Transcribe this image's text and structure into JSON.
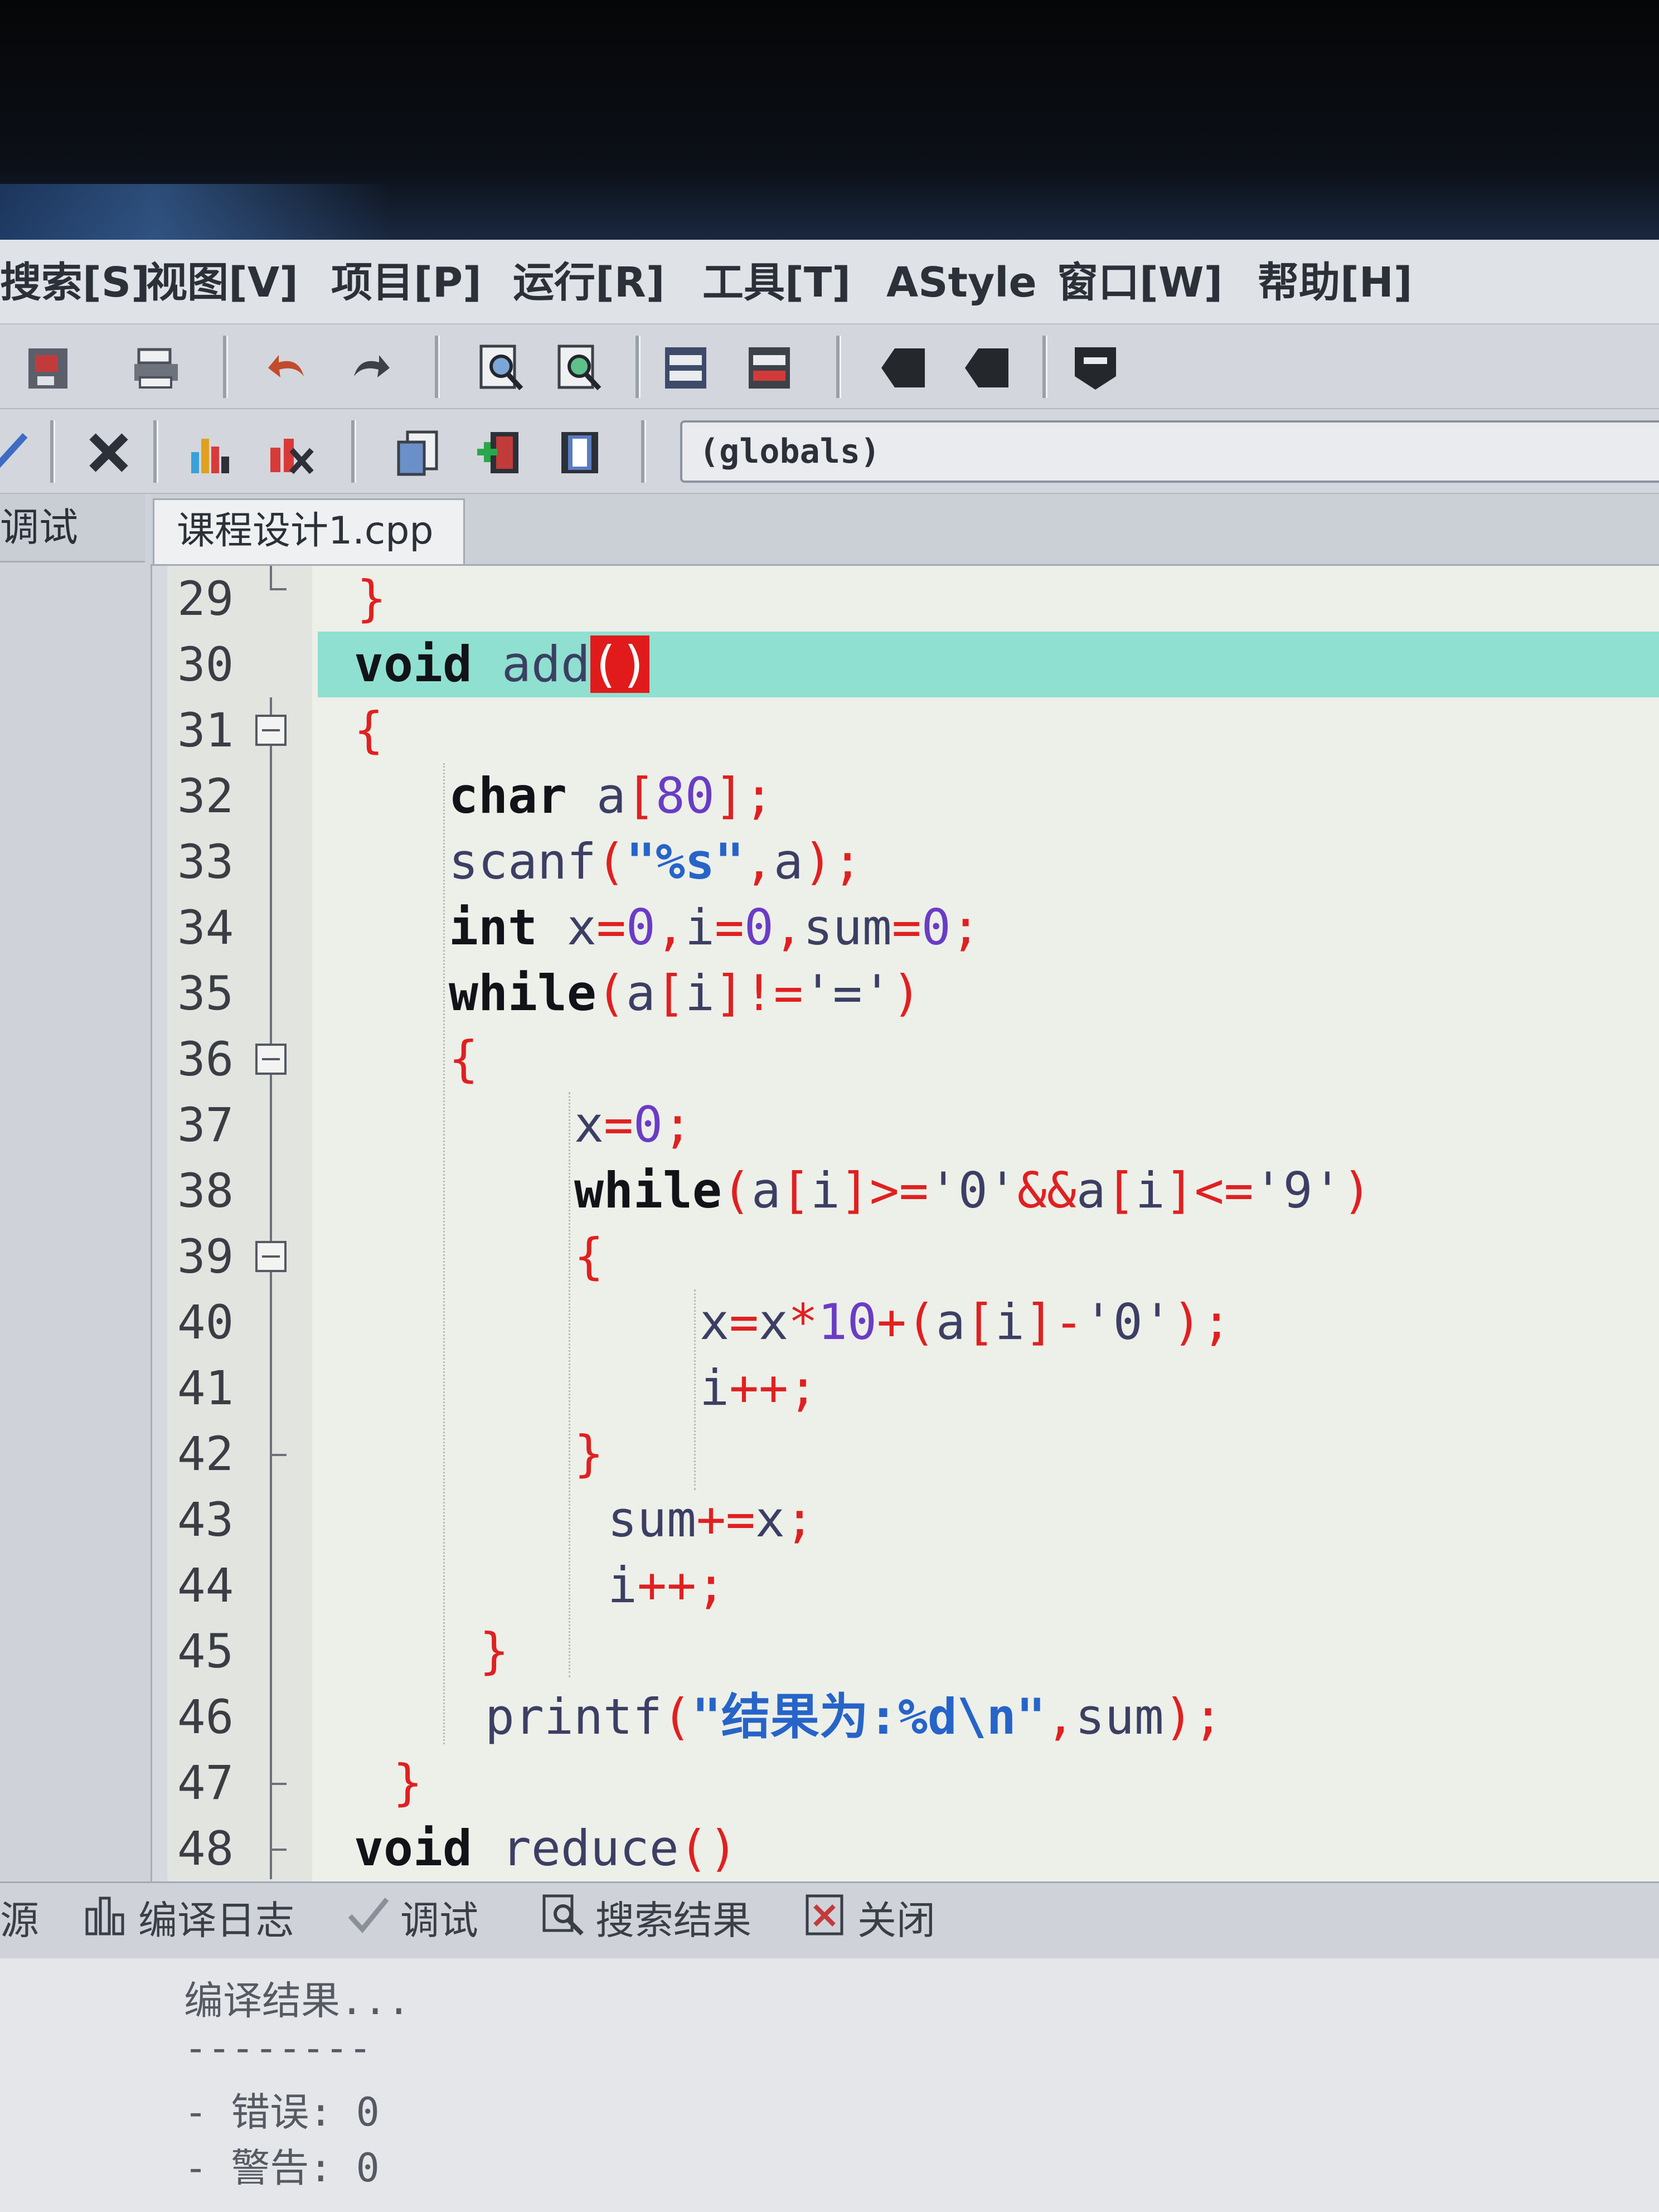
{
  "menu": [
    "搜索[S]",
    "视图[V]",
    "项目[P]",
    "运行[R]",
    "工具[T]",
    "AStyle",
    "窗口[W]",
    "帮助[H]"
  ],
  "toolbar": {
    "globals_value": "(globals)"
  },
  "left_panel": {
    "tab_label": "调试"
  },
  "editor": {
    "file_tab": "课程设计1.cpp",
    "line_numbers": [
      "29",
      "30",
      "31",
      "32",
      "33",
      "34",
      "35",
      "36",
      "37",
      "38",
      "39",
      "40",
      "41",
      "42",
      "43",
      "44",
      "45",
      "46",
      "47",
      "48"
    ]
  },
  "bottom": {
    "tabs": [
      "源",
      "编译日志",
      "调试",
      "搜索结果",
      "关闭"
    ],
    "log": [
      "编译结果...",
      "--------",
      "- 错误: 0",
      "- 警告: 0"
    ]
  },
  "colors": {
    "current_line": "#8fe0d0",
    "brace_match": "#e11b1b",
    "keyword": "#111318",
    "symbol": "#e02020",
    "number": "#6a3cc6",
    "string": "#2664c8"
  }
}
